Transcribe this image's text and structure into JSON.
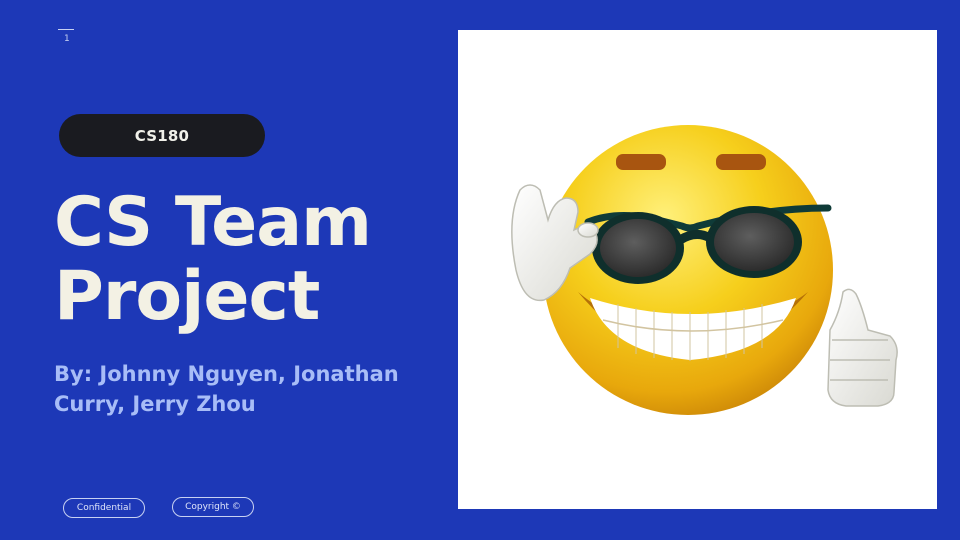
{
  "slide": {
    "page_number": "1",
    "tag": "CS180",
    "title_line1": "CS Team",
    "title_line2": "Project",
    "byline_line1": "By: Johnny Nguyen, Jonathan",
    "byline_line2": "Curry, Jerry Zhou",
    "footer": {
      "confidential": "Confidential",
      "copyright": "Copyright ©"
    }
  },
  "image": {
    "subject": "sunglasses-emoji",
    "colors": {
      "background": "#1d38b7",
      "pill": "#1a1b20",
      "title": "#f3f1e4",
      "byline": "#a8bdf7",
      "face": "#f2c415"
    }
  }
}
